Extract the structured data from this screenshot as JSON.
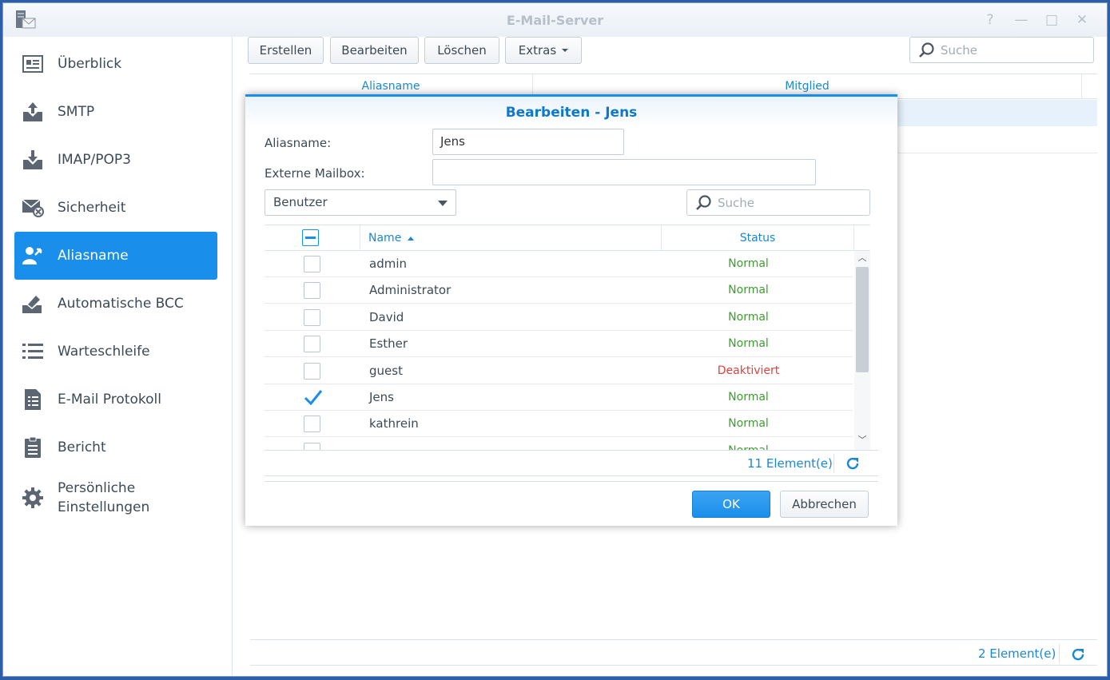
{
  "window": {
    "title": "E-Mail-Server",
    "help": "?",
    "minimize": "—",
    "maximize": "□",
    "close": "✕"
  },
  "sidebar": {
    "items": [
      {
        "label": "Überblick",
        "icon": "overview-icon",
        "active": false
      },
      {
        "label": "SMTP",
        "icon": "smtp-upload-icon",
        "active": false
      },
      {
        "label": "IMAP/POP3",
        "icon": "imap-download-icon",
        "active": false
      },
      {
        "label": "Sicherheit",
        "icon": "security-mail-icon",
        "active": false
      },
      {
        "label": "Aliasname",
        "icon": "alias-user-icon",
        "active": true
      },
      {
        "label": "Automatische BCC",
        "icon": "bcc-icon",
        "active": false
      },
      {
        "label": "Warteschleife",
        "icon": "queue-list-icon",
        "active": false
      },
      {
        "label": "E-Mail Protokoll",
        "icon": "log-icon",
        "active": false
      },
      {
        "label": "Bericht",
        "icon": "report-clipboard-icon",
        "active": false
      },
      {
        "label_line1": "Persönliche",
        "label_line2": "Einstellungen",
        "icon": "gear-icon",
        "active": false
      }
    ]
  },
  "toolbar": {
    "create": "Erstellen",
    "edit": "Bearbeiten",
    "delete": "Löschen",
    "extras": "Extras",
    "search_placeholder": "Suche"
  },
  "alias_grid": {
    "columns": [
      "Aliasname",
      "Mitglied"
    ],
    "count": "2 Element(e)"
  },
  "dialog": {
    "title": "Bearbeiten - Jens",
    "alias_label": "Aliasname:",
    "alias_value": "Jens",
    "mailbox_label": "Externe Mailbox:",
    "mailbox_value": "",
    "filter_value": "Benutzer",
    "search_placeholder": "Suche",
    "columns": {
      "name": "Name",
      "status": "Status"
    },
    "users": [
      {
        "name": "admin",
        "status": "Normal",
        "checked": false
      },
      {
        "name": "Administrator",
        "status": "Normal",
        "checked": false
      },
      {
        "name": "David",
        "status": "Normal",
        "checked": false
      },
      {
        "name": "Esther",
        "status": "Normal",
        "checked": false
      },
      {
        "name": "guest",
        "status": "Deaktiviert",
        "checked": false
      },
      {
        "name": "Jens",
        "status": "Normal",
        "checked": true
      },
      {
        "name": "kathrein",
        "status": "Normal",
        "checked": false
      },
      {
        "name": "",
        "status": "Normal",
        "checked": false
      }
    ],
    "count": "11 Element(e)",
    "ok": "OK",
    "cancel": "Abbrechen"
  },
  "colors": {
    "accent": "#1a8eeb",
    "normal": "#3aa02b",
    "disabled": "#e0433d"
  }
}
